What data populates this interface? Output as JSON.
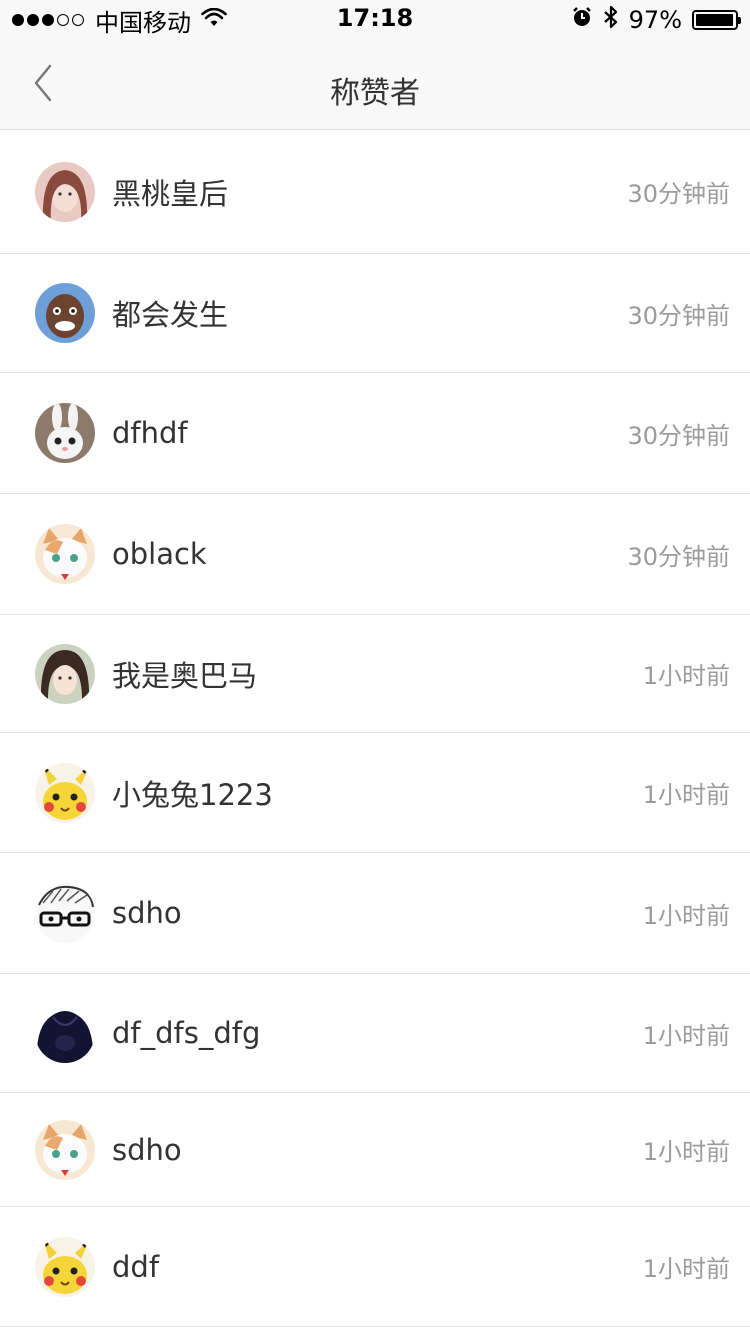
{
  "status_bar": {
    "signal_full": 3,
    "signal_empty": 2,
    "carrier": "中国移动",
    "time": "17:18",
    "battery_text": "97%",
    "battery_level": 0.97,
    "icons": [
      "wifi-icon",
      "alarm-icon",
      "bluetooth-icon",
      "battery-icon"
    ]
  },
  "nav": {
    "title": "称赞者",
    "back_icon": "chevron-left-icon"
  },
  "likers": [
    {
      "name": "黑桃皇后",
      "time": "30分钟前",
      "avatar": "girl-photo-1"
    },
    {
      "name": "都会发生",
      "time": "30分钟前",
      "avatar": "man-caricature"
    },
    {
      "name": "dfhdf",
      "time": "30分钟前",
      "avatar": "white-rabbit"
    },
    {
      "name": "oblack",
      "time": "30分钟前",
      "avatar": "cartoon-cat"
    },
    {
      "name": "我是奥巴马",
      "time": "1小时前",
      "avatar": "girl-photo-2"
    },
    {
      "name": "小兔兔1223",
      "time": "1小时前",
      "avatar": "pikachu"
    },
    {
      "name": "sdho",
      "time": "1小时前",
      "avatar": "sketch-glasses"
    },
    {
      "name": "df_dfs_dfg",
      "time": "1小时前",
      "avatar": "dark-figure"
    },
    {
      "name": "sdho",
      "time": "1小时前",
      "avatar": "cartoon-cat"
    },
    {
      "name": "ddf",
      "time": "1小时前",
      "avatar": "pikachu"
    }
  ]
}
